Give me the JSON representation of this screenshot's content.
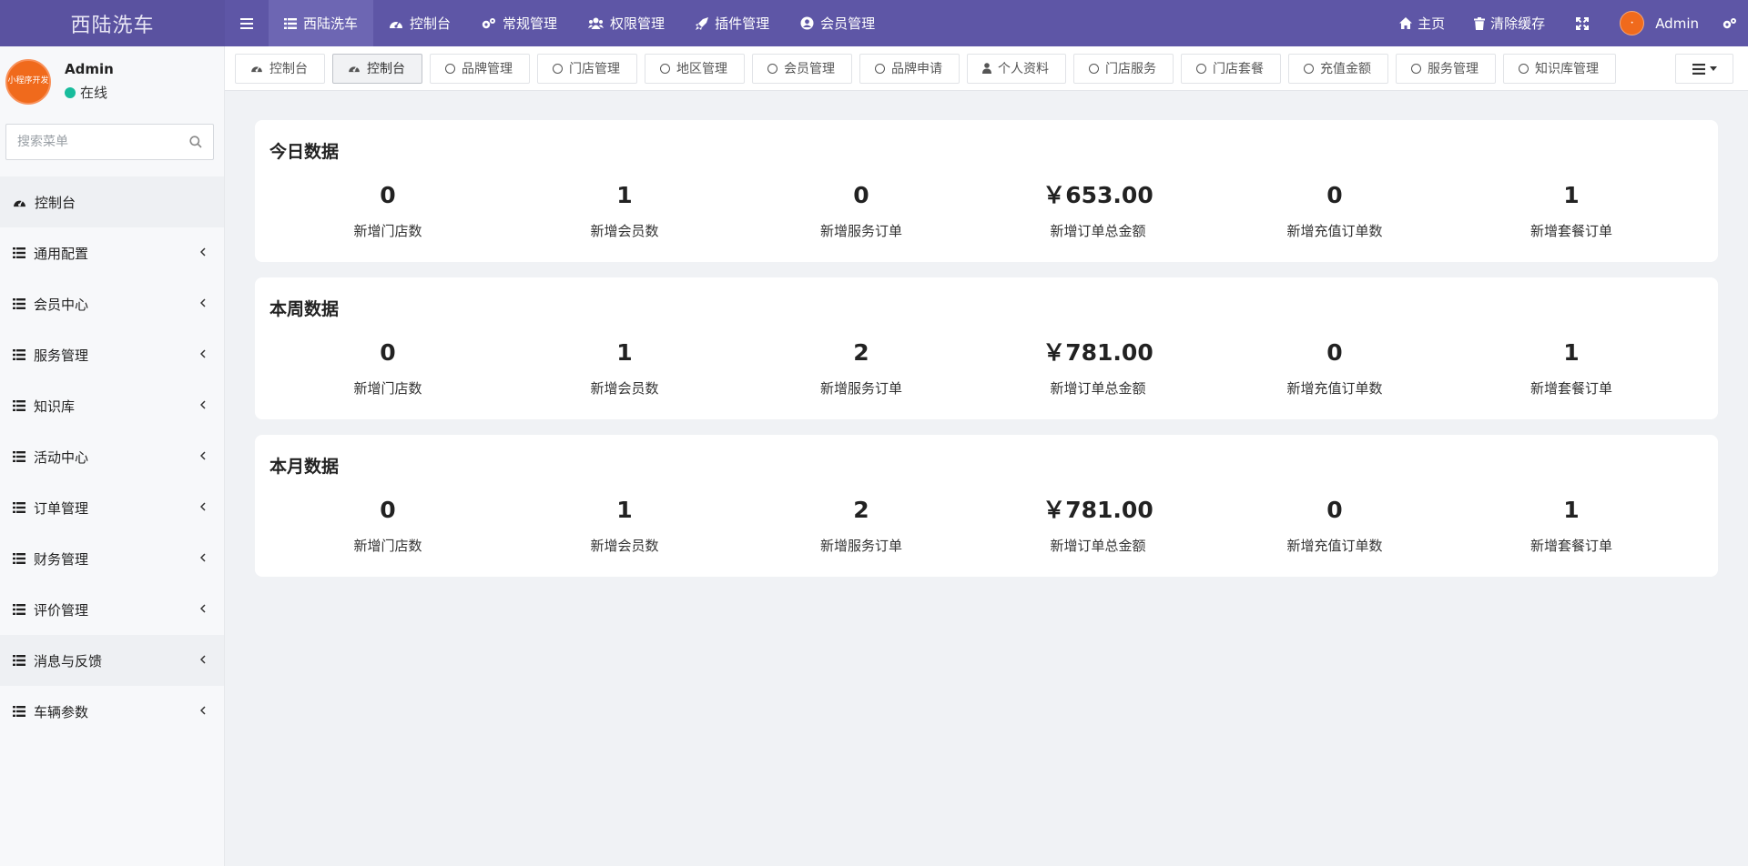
{
  "app": {
    "title": "西陆洗车",
    "brand_color": "#5e56a6"
  },
  "topnav": [
    {
      "label": "西陆洗车",
      "icon": "list-icon",
      "active": true
    },
    {
      "label": "控制台",
      "icon": "dashboard-icon",
      "active": false
    },
    {
      "label": "常规管理",
      "icon": "cogs-icon",
      "active": false
    },
    {
      "label": "权限管理",
      "icon": "users-icon",
      "active": false
    },
    {
      "label": "插件管理",
      "icon": "rocket-icon",
      "active": false
    },
    {
      "label": "会员管理",
      "icon": "user-circle-icon",
      "active": false
    }
  ],
  "topright": {
    "home": "主页",
    "clear_cache": "清除缓存",
    "admin": "Admin"
  },
  "sidebar": {
    "user_name": "Admin",
    "status": "在线",
    "avatar_text": "小程序开发",
    "search_placeholder": "搜索菜单",
    "items": [
      {
        "label": "控制台",
        "icon": "dashboard-icon",
        "has_children": false,
        "active": true
      },
      {
        "label": "通用配置",
        "icon": "list-icon",
        "has_children": true
      },
      {
        "label": "会员中心",
        "icon": "list-icon",
        "has_children": true
      },
      {
        "label": "服务管理",
        "icon": "list-icon",
        "has_children": true
      },
      {
        "label": "知识库",
        "icon": "list-icon",
        "has_children": true
      },
      {
        "label": "活动中心",
        "icon": "list-icon",
        "has_children": true
      },
      {
        "label": "订单管理",
        "icon": "list-icon",
        "has_children": true
      },
      {
        "label": "财务管理",
        "icon": "list-icon",
        "has_children": true
      },
      {
        "label": "评价管理",
        "icon": "list-icon",
        "has_children": true
      },
      {
        "label": "消息与反馈",
        "icon": "list-icon",
        "has_children": true,
        "hover": true
      },
      {
        "label": "车辆参数",
        "icon": "list-icon",
        "has_children": true
      }
    ]
  },
  "tabs": [
    {
      "label": "控制台",
      "icon": "dashboard-icon"
    },
    {
      "label": "控制台",
      "icon": "dashboard-icon",
      "active": true
    },
    {
      "label": "品牌管理",
      "icon": "circle-icon"
    },
    {
      "label": "门店管理",
      "icon": "circle-icon"
    },
    {
      "label": "地区管理",
      "icon": "circle-icon"
    },
    {
      "label": "会员管理",
      "icon": "circle-icon"
    },
    {
      "label": "品牌申请",
      "icon": "circle-icon"
    },
    {
      "label": "个人资料",
      "icon": "user-icon"
    },
    {
      "label": "门店服务",
      "icon": "circle-icon"
    },
    {
      "label": "门店套餐",
      "icon": "circle-icon"
    },
    {
      "label": "充值金额",
      "icon": "circle-icon"
    },
    {
      "label": "服务管理",
      "icon": "circle-icon"
    },
    {
      "label": "知识库管理",
      "icon": "circle-icon"
    }
  ],
  "cards": [
    {
      "title": "今日数据",
      "stats": [
        {
          "value": "0",
          "label": "新增门店数"
        },
        {
          "value": "1",
          "label": "新增会员数"
        },
        {
          "value": "0",
          "label": "新增服务订单"
        },
        {
          "value": "￥653.00",
          "label": "新增订单总金额"
        },
        {
          "value": "0",
          "label": "新增充值订单数"
        },
        {
          "value": "1",
          "label": "新增套餐订单"
        }
      ]
    },
    {
      "title": "本周数据",
      "stats": [
        {
          "value": "0",
          "label": "新增门店数"
        },
        {
          "value": "1",
          "label": "新增会员数"
        },
        {
          "value": "2",
          "label": "新增服务订单"
        },
        {
          "value": "￥781.00",
          "label": "新增订单总金额"
        },
        {
          "value": "0",
          "label": "新增充值订单数"
        },
        {
          "value": "1",
          "label": "新增套餐订单"
        }
      ]
    },
    {
      "title": "本月数据",
      "stats": [
        {
          "value": "0",
          "label": "新增门店数"
        },
        {
          "value": "1",
          "label": "新增会员数"
        },
        {
          "value": "2",
          "label": "新增服务订单"
        },
        {
          "value": "￥781.00",
          "label": "新增订单总金额"
        },
        {
          "value": "0",
          "label": "新增充值订单数"
        },
        {
          "value": "1",
          "label": "新增套餐订单"
        }
      ]
    }
  ]
}
